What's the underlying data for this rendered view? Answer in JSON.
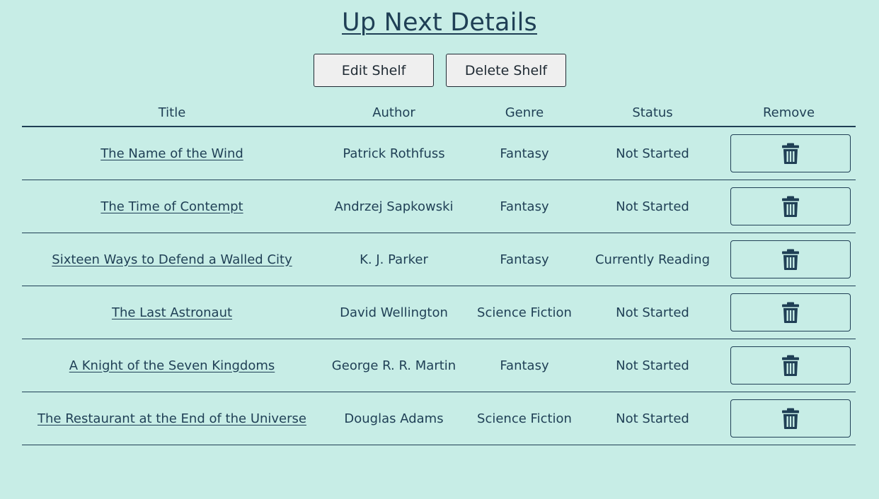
{
  "page": {
    "title": "Up Next Details"
  },
  "actions": {
    "edit_label": "Edit Shelf",
    "delete_label": "Delete Shelf"
  },
  "table": {
    "headers": [
      "Title",
      "Author",
      "Genre",
      "Status",
      "Remove"
    ],
    "rows": [
      {
        "title": "The Name of the Wind",
        "author": "Patrick Rothfuss",
        "genre": "Fantasy",
        "status": "Not Started"
      },
      {
        "title": "The Time of Contempt",
        "author": "Andrzej Sapkowski",
        "genre": "Fantasy",
        "status": "Not Started"
      },
      {
        "title": "Sixteen Ways to Defend a Walled City",
        "author": "K. J. Parker",
        "genre": "Fantasy",
        "status": "Currently Reading"
      },
      {
        "title": "The Last Astronaut",
        "author": "David Wellington",
        "genre": "Science Fiction",
        "status": "Not Started"
      },
      {
        "title": "A Knight of the Seven Kingdoms",
        "author": "George R. R. Martin",
        "genre": "Fantasy",
        "status": "Not Started"
      },
      {
        "title": "The Restaurant at the End of the Universe",
        "author": "Douglas Adams",
        "genre": "Science Fiction",
        "status": "Not Started"
      }
    ],
    "remove_icon": "trash-icon"
  },
  "colors": {
    "background": "#c7ede6",
    "text": "#1f3f55",
    "button_bg": "#efefef"
  }
}
